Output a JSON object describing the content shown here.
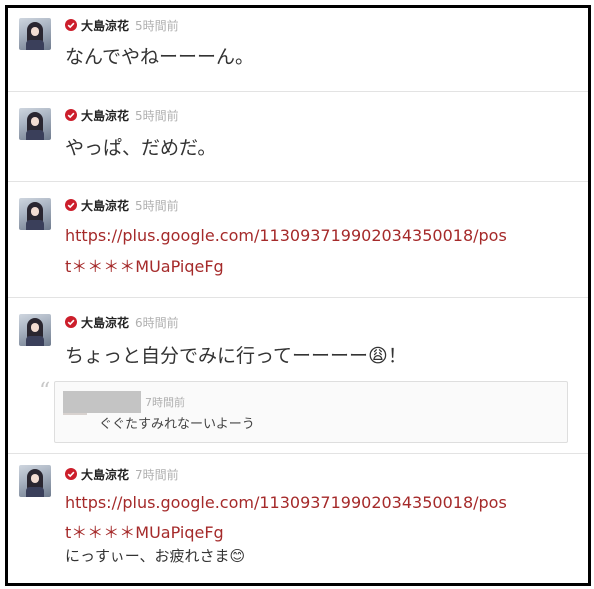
{
  "posts": [
    {
      "author": "大島涼花",
      "time": "5時間前",
      "text": "なんでやねーーーん。"
    },
    {
      "author": "大島涼花",
      "time": "5時間前",
      "text": "やっぱ、だめだ。"
    },
    {
      "author": "大島涼花",
      "time": "5時間前",
      "link_line1": "https://plus.google.com/113093719902034350018/pos",
      "link_line2": "t＊＊＊＊MUaPiqeFg"
    },
    {
      "author": "大島涼花",
      "time": "6時間前",
      "text": "ちょっと自分でみに行ってーーーー😩！",
      "comment": {
        "time": "7時間前",
        "text": "ぐぐたすみれなーいよーう"
      }
    },
    {
      "author": "大島涼花",
      "time": "7時間前",
      "link_line1": "https://plus.google.com/113093719902034350018/pos",
      "link_line2": "t＊＊＊＊MUaPiqeFg",
      "text": "にっすぃー、お疲れさま😊"
    }
  ],
  "icons": {
    "verified": "verified-badge-icon",
    "quote": "quote-icon"
  },
  "colors": {
    "link": "#a52a2a",
    "verified": "#cc1e2b"
  }
}
